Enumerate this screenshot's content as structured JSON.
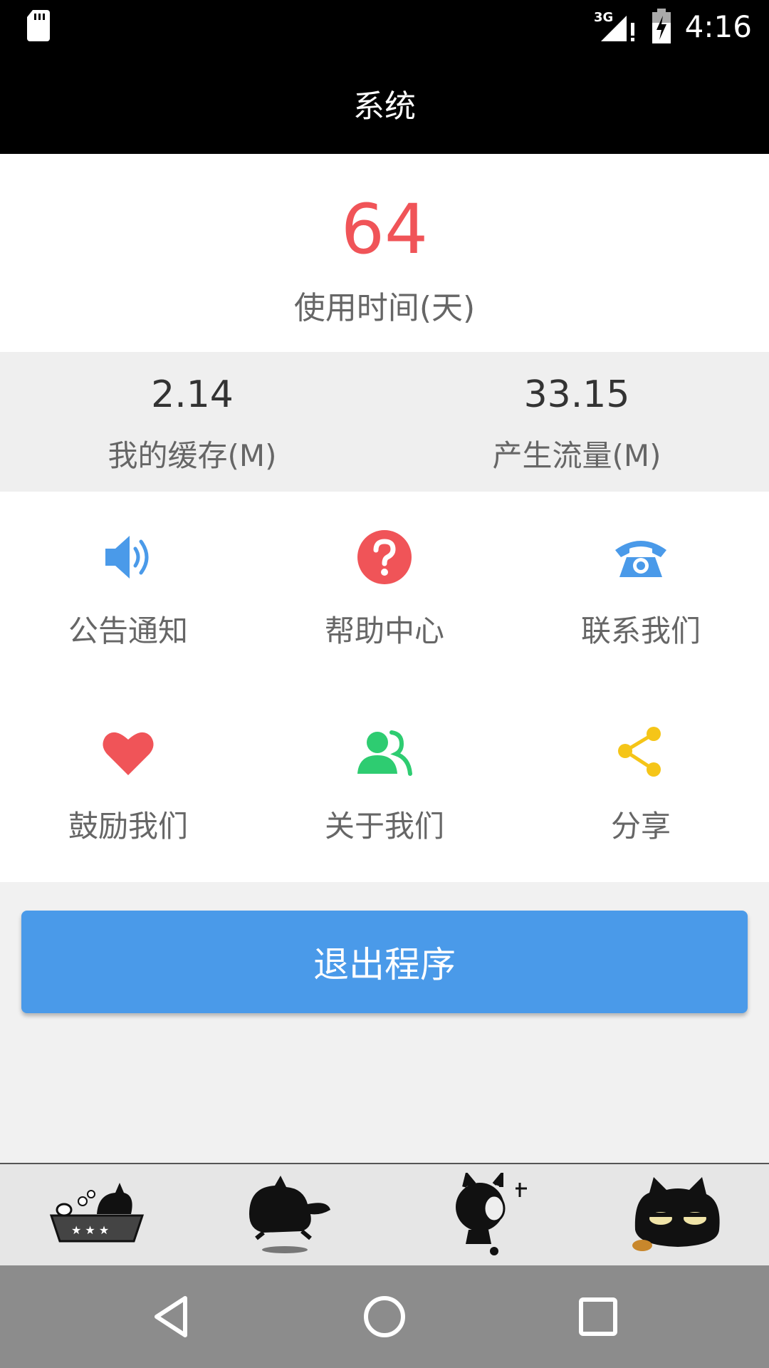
{
  "status_bar": {
    "network": "3G",
    "time": "4:16"
  },
  "title": "系统",
  "usage": {
    "value": "64",
    "label": "使用时间(天)",
    "color": "#f05458"
  },
  "stats": [
    {
      "value": "2.14",
      "label": "我的缓存(M)"
    },
    {
      "value": "33.15",
      "label": "产生流量(M)"
    }
  ],
  "grid_items": [
    {
      "label": "公告通知",
      "icon": "speaker-icon",
      "color": "#4a9ae9"
    },
    {
      "label": "帮助中心",
      "icon": "question-icon",
      "color": "#f05458"
    },
    {
      "label": "联系我们",
      "icon": "phone-icon",
      "color": "#4a9ae9"
    },
    {
      "label": "鼓励我们",
      "icon": "heart-icon",
      "color": "#f05458"
    },
    {
      "label": "关于我们",
      "icon": "users-icon",
      "color": "#2ecc71"
    },
    {
      "label": "分享",
      "icon": "share-icon",
      "color": "#f5c518"
    }
  ],
  "exit_button": {
    "label": "退出程序",
    "color": "#4a9ae9"
  },
  "stickers": [
    "cat-bath-sticker",
    "cat-running-sticker",
    "cat-crying-sticker",
    "cat-glaring-sticker"
  ],
  "nav": [
    "back-icon",
    "home-icon",
    "recents-icon"
  ]
}
